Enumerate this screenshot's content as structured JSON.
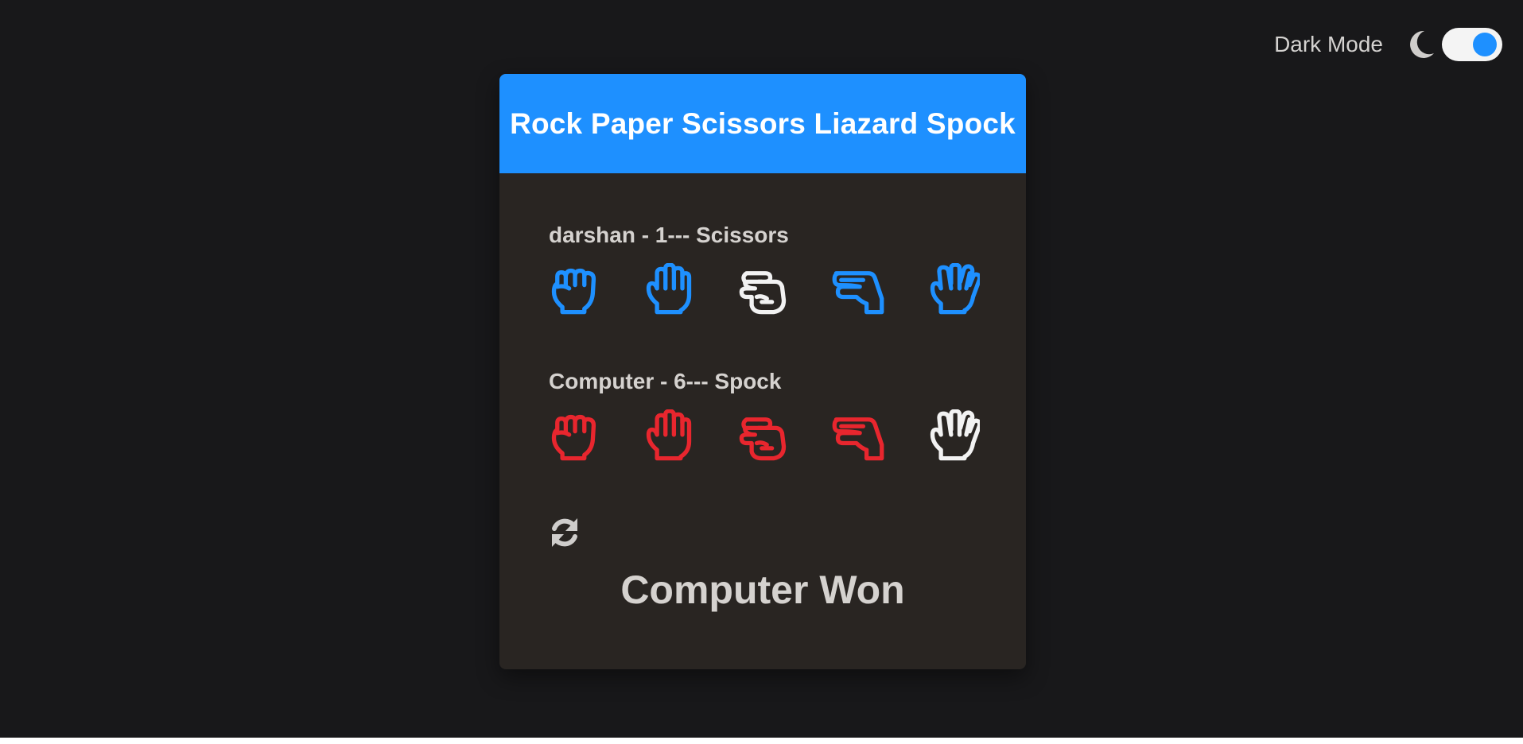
{
  "header": {
    "dark_mode_label": "Dark Mode",
    "dark_mode_on": true
  },
  "game": {
    "title": "Rock Paper Scissors Liazard Spock",
    "player": {
      "label": "darshan - 1--- Scissors",
      "name": "darshan",
      "score": "1",
      "choice": "Scissors",
      "color": "#1e90ff"
    },
    "computer": {
      "label": "Computer - 6--- Spock",
      "name": "Computer",
      "score": "6",
      "choice": "Spock",
      "color": "#e8262e"
    },
    "hands": [
      "rock-icon",
      "paper-icon",
      "scissors-icon",
      "lizard-icon",
      "spock-icon"
    ],
    "selected_color": "#f2f2f2",
    "result": "Computer Won"
  },
  "colors": {
    "background": "#18181a",
    "card": "#292522",
    "accent": "#1e90ff"
  }
}
